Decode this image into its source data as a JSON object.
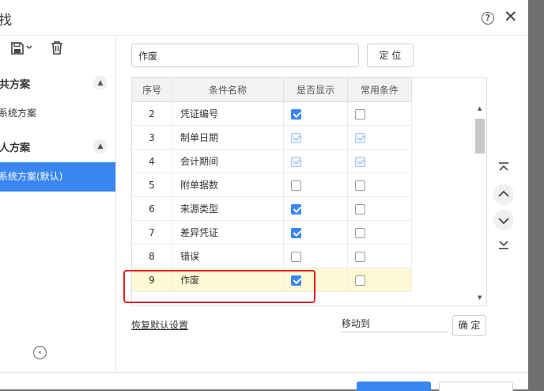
{
  "dialog": {
    "title_fragment": "找",
    "help_icon": "?",
    "close_icon": "✕"
  },
  "left_panel": {
    "toolbar": {
      "save_icon": "save-icon",
      "dropdown_icon": "chevron-down-icon",
      "delete_icon": "trash-icon"
    },
    "groups": [
      {
        "label": "共方案",
        "items": [
          {
            "label": "系统方案",
            "active": false
          }
        ]
      },
      {
        "label": "人方案",
        "items": [
          {
            "label": "系统方案(默认)",
            "active": true
          }
        ]
      }
    ],
    "collapse_icon": "chevron-left-circle-icon"
  },
  "search": {
    "value": "作废"
  },
  "locate_button": "定 位",
  "grid": {
    "columns": [
      "序号",
      "条件名称",
      "是否显示",
      "常用条件"
    ],
    "rows": [
      {
        "idx": "2",
        "name": "凭证编号",
        "show": "checked",
        "common": "unchecked",
        "selected": false
      },
      {
        "idx": "3",
        "name": "制单日期",
        "show": "checked-disabled",
        "common": "checked-disabled",
        "selected": false
      },
      {
        "idx": "4",
        "name": "会计期间",
        "show": "checked-disabled",
        "common": "checked-disabled",
        "selected": false
      },
      {
        "idx": "5",
        "name": "附单据数",
        "show": "unchecked",
        "common": "unchecked",
        "selected": false
      },
      {
        "idx": "6",
        "name": "来源类型",
        "show": "checked",
        "common": "unchecked",
        "selected": false
      },
      {
        "idx": "7",
        "name": "差异凭证",
        "show": "checked",
        "common": "unchecked",
        "selected": false
      },
      {
        "idx": "8",
        "name": "错误",
        "show": "unchecked",
        "common": "unchecked",
        "selected": false
      },
      {
        "idx": "9",
        "name": "作废",
        "show": "checked",
        "common": "unchecked",
        "selected": true
      }
    ]
  },
  "restore_default": "恢复默认设置",
  "move_to": {
    "value": "移动到"
  },
  "confirm_button": "确 定",
  "colors": {
    "accent": "#3a86f0",
    "highlight_row": "#fff8d5",
    "annotation": "#e02020"
  }
}
